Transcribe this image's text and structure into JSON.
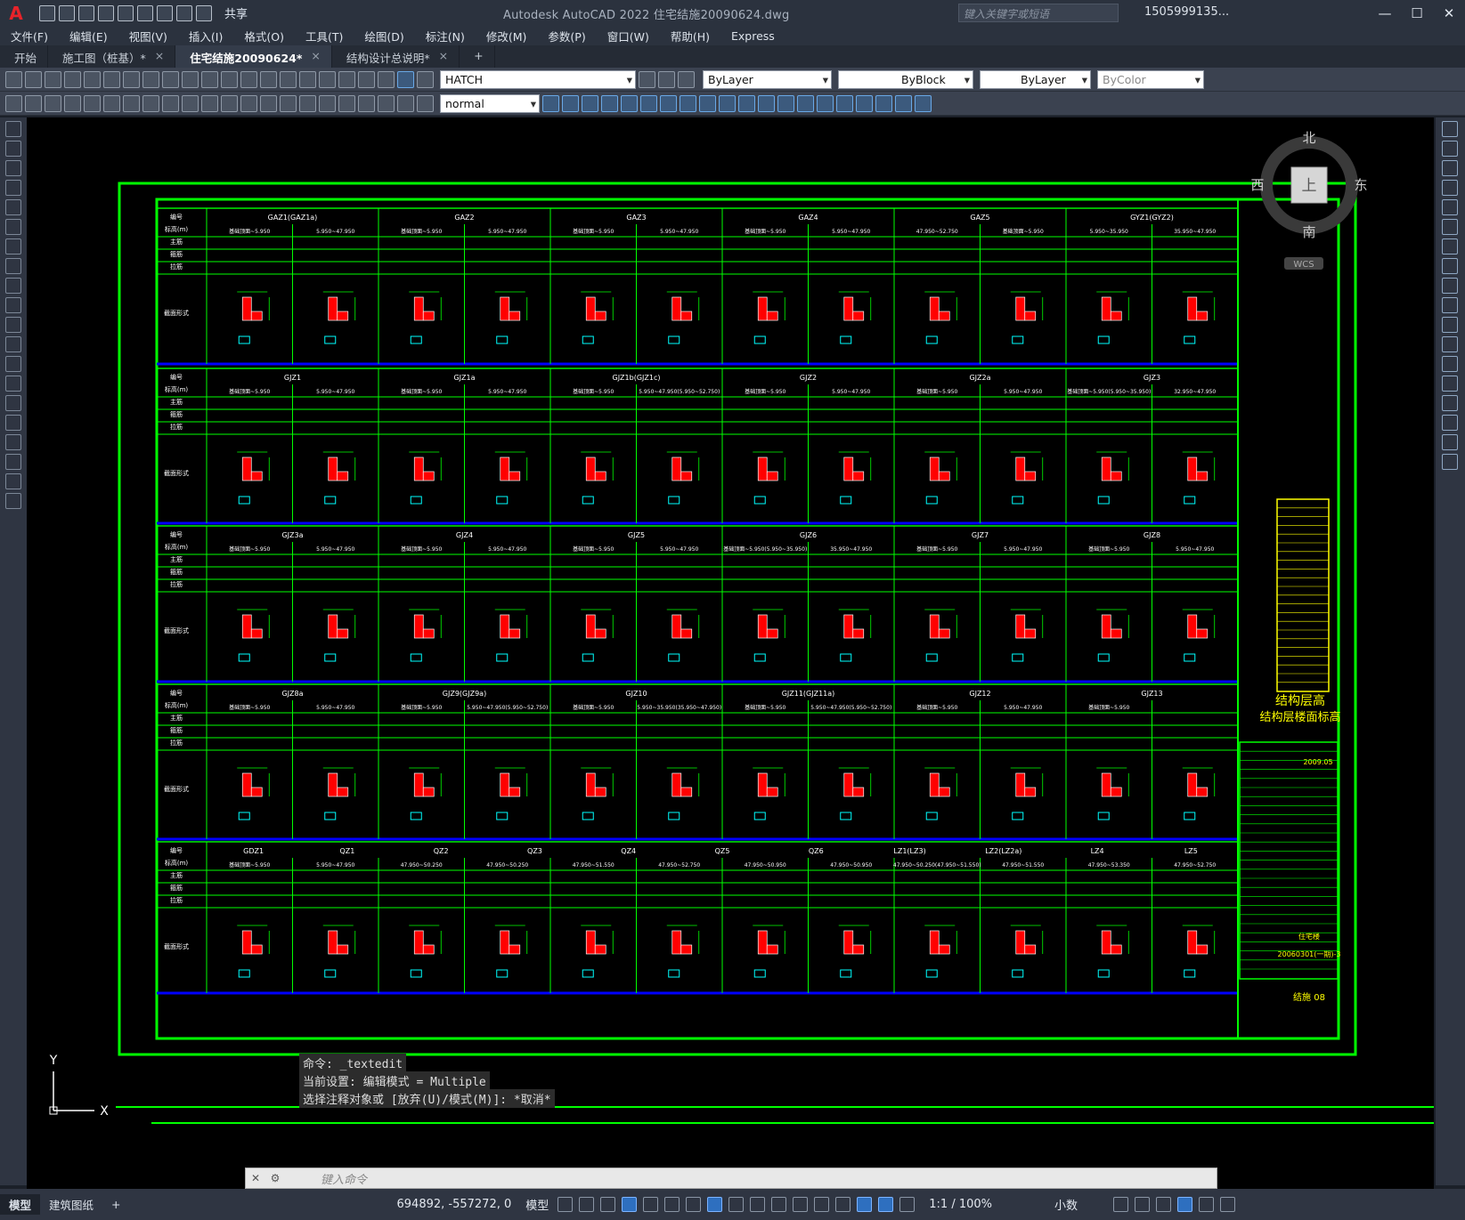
{
  "app": {
    "logo": "A",
    "title": "Autodesk AutoCAD 2022    住宅结施20090624.dwg",
    "share": "共享",
    "search_placeholder": "键入关键字或短语",
    "user": "1505999135...",
    "accent": "#e8232a"
  },
  "menu": [
    "文件(F)",
    "编辑(E)",
    "视图(V)",
    "插入(I)",
    "格式(O)",
    "工具(T)",
    "绘图(D)",
    "标注(N)",
    "修改(M)",
    "参数(P)",
    "窗口(W)",
    "帮助(H)",
    "Express"
  ],
  "tabs": [
    {
      "label": "开始"
    },
    {
      "label": "施工图（桩基）*"
    },
    {
      "label": "住宅结施20090624*"
    },
    {
      "label": "结构设计总说明*"
    },
    {
      "label": "+"
    }
  ],
  "toolbar": {
    "layer": "HATCH",
    "color": "ByLayer",
    "linetype": "ByBlock",
    "lineweight": "ByLayer",
    "plotstyle": "ByColor",
    "textstyle": "normal"
  },
  "viewcube": {
    "north": "北",
    "south": "南",
    "east": "东",
    "west": "西",
    "top": "上",
    "wcs": "WCS"
  },
  "command": {
    "lines": [
      "命令: _textedit",
      "当前设置: 编辑模式 = Multiple",
      "选择注释对象或 [放弃(U)/模式(M)]: *取消*"
    ],
    "placeholder": "键入命令"
  },
  "status": {
    "layouts": [
      "模型",
      "建筑图纸",
      "+"
    ],
    "coords": "694892, -557272, 0",
    "model": "模型",
    "scale": "1:1 / 100%",
    "units": "小数"
  },
  "drawing": {
    "table": {
      "header_cells": [
        "编号",
        "标高(m)",
        "主筋",
        "箍筋",
        "拉筋"
      ],
      "section_label": "截面形式"
    },
    "rows": [
      {
        "names": [
          "GAZ1(GAZ1a)",
          "GAZ2",
          "GAZ3",
          "GAZ4",
          "GAZ5",
          "GYZ1(GYZ2)"
        ],
        "elev": [
          "基础顶面~5.950",
          "5.950~47.950",
          "基础顶面~5.950",
          "5.950~47.950",
          "基础顶面~5.950",
          "5.950~47.950",
          "基础顶面~5.950",
          "5.950~47.950",
          "47.950~52.750",
          "基础顶面~5.950",
          "5.950~35.950",
          "35.950~47.950"
        ]
      },
      {
        "names": [
          "GJZ1",
          "GJZ1a",
          "GJZ1b(GJZ1c)",
          "GJZ2",
          "GJZ2a",
          "GJZ3"
        ],
        "elev": [
          "基础顶面~5.950",
          "5.950~47.950",
          "基础顶面~5.950",
          "5.950~47.950",
          "基础顶面~5.950",
          "5.950~47.950(5.950~52.750)",
          "基础顶面~5.950",
          "5.950~47.950",
          "基础顶面~5.950",
          "5.950~47.950",
          "基础顶面~5.950(5.950~35.950)",
          "32.950~47.950"
        ]
      },
      {
        "names": [
          "GJZ3a",
          "GJZ4",
          "GJZ5",
          "GJZ6",
          "GJZ7",
          "GJZ8"
        ],
        "elev": [
          "基础顶面~5.950",
          "5.950~47.950",
          "基础顶面~5.950",
          "5.950~47.950",
          "基础顶面~5.950",
          "5.950~47.950",
          "基础顶面~5.950(5.950~35.950)",
          "35.950~47.950",
          "基础顶面~5.950",
          "5.950~47.950",
          "基础顶面~5.950",
          "5.950~47.950"
        ]
      },
      {
        "names": [
          "GJZ8a",
          "GJZ9(GJZ9a)",
          "GJZ10",
          "GJZ11(GJZ11a)",
          "GJZ12",
          "GJZ13"
        ],
        "elev": [
          "基础顶面~5.950",
          "5.950~47.950",
          "基础顶面~5.950",
          "5.950~47.950(5.950~52.750)",
          "基础顶面~5.950",
          "5.950~35.950(35.950~47.950)",
          "基础顶面~5.950",
          "5.950~47.950(5.950~52.750)",
          "基础顶面~5.950",
          "5.950~47.950",
          "基础顶面~5.950",
          ""
        ]
      },
      {
        "names": [
          "GDZ1",
          "QZ1",
          "QZ2",
          "QZ3",
          "QZ4",
          "QZ5",
          "QZ6",
          "LZ1(LZ3)",
          "LZ2(LZ2a)",
          "LZ4",
          "LZ5"
        ],
        "elev": [
          "基础顶面~5.950",
          "5.950~47.950",
          "47.950~50.250",
          "47.950~50.250",
          "47.950~51.550",
          "47.950~52.750",
          "47.950~50.950",
          "47.950~50.950",
          "47.950~50.250(47.950~51.550)",
          "47.950~51.550",
          "47.950~53.350",
          "47.950~52.750"
        ]
      }
    ],
    "side": {
      "story_title": "结构层高",
      "story_subtitle": "结构层楼面标高",
      "date": "2009.05",
      "project_no": "20060301(一期)-3",
      "sheet": "结施 08",
      "subproject": "住宅楼"
    }
  }
}
